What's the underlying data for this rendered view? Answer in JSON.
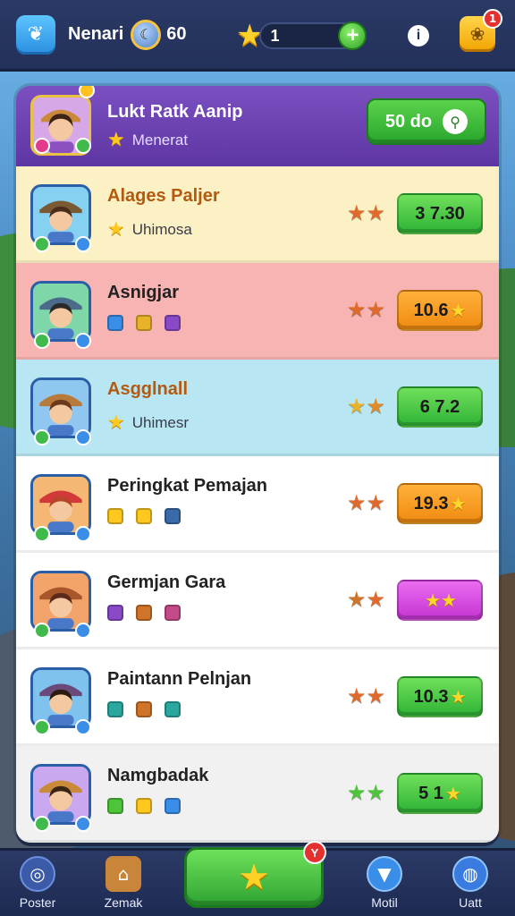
{
  "topbar": {
    "player_name": "Nenari",
    "coins": "60",
    "level": "1",
    "info_label": "i",
    "gift_badge": "1"
  },
  "header_row": {
    "title": "Lukt Ratk Aanip",
    "subtitle": "Menerat",
    "button_label": "50 do"
  },
  "players": [
    {
      "name": "Alages Paljer",
      "subtitle": "Uhimosa",
      "score": "3 7.30",
      "score_color": "green",
      "bg": "#fcf1c4",
      "name_color": "#b25a10",
      "star_shown": true
    },
    {
      "name": "Asnigjar",
      "subtitle": "",
      "score": "10.6",
      "score_color": "orange",
      "bg": "#f8b3b3",
      "name_color": "#222222",
      "star_shown": true
    },
    {
      "name": "Asgglnall",
      "subtitle": "Uhimesr",
      "score": "6 7.2",
      "score_color": "green",
      "bg": "#b9e6f3",
      "name_color": "#b25a10",
      "star_shown": false
    },
    {
      "name": "Peringkat Pemajan",
      "subtitle": "",
      "score": "19.3",
      "score_color": "orange",
      "bg": "#ffffff",
      "name_color": "#222222",
      "star_shown": true
    },
    {
      "name": "Germjan Gara",
      "subtitle": "",
      "score": "",
      "score_color": "purple",
      "bg": "#ffffff",
      "name_color": "#222222",
      "star_shown": true
    },
    {
      "name": "Paintann Pelnjan",
      "subtitle": "",
      "score": "10.3",
      "score_color": "green",
      "bg": "#ffffff",
      "name_color": "#222222",
      "star_shown": true
    },
    {
      "name": "Namgbadak",
      "subtitle": "",
      "score": "5 1",
      "score_color": "green",
      "bg": "#f1f1f1",
      "name_color": "#222222",
      "star_shown": true
    }
  ],
  "bottom_nav": {
    "items": [
      {
        "label": "Poster",
        "icon": "target-icon"
      },
      {
        "label": "Zemak",
        "icon": "house-icon"
      },
      {
        "label": "Motil",
        "icon": "shield-icon"
      },
      {
        "label": "Uatt",
        "icon": "globe-icon"
      }
    ],
    "center_badge": "Y"
  }
}
